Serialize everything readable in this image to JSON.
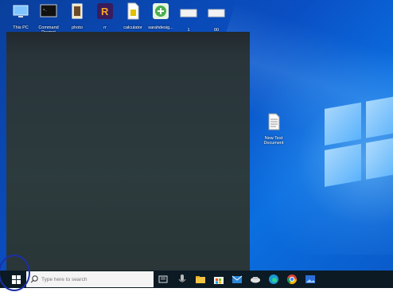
{
  "desktop": {
    "icons": [
      {
        "label": "This PC",
        "icon": "computer-icon"
      },
      {
        "label": "Command Prompt",
        "icon": "terminal-icon"
      },
      {
        "label": "photo",
        "icon": "photo-icon"
      },
      {
        "label": "rr",
        "icon": "app-icon"
      },
      {
        "label": "calculator",
        "icon": "document-icon"
      },
      {
        "label": "sarahdesig...",
        "icon": "app-icon"
      },
      {
        "label": "1",
        "icon": "folder-icon"
      },
      {
        "label": "00",
        "icon": "folder-icon"
      }
    ],
    "file_icon": {
      "label": "New Text Document",
      "icon": "text-file-icon"
    }
  },
  "taskbar": {
    "search": {
      "placeholder": "Type here to search"
    },
    "pinned": [
      "task-view-icon",
      "microphone-icon",
      "file-explorer-icon",
      "store-icon",
      "mail-icon",
      "phone-icon",
      "edge-icon",
      "chrome-icon",
      "photos-icon"
    ]
  },
  "colors": {
    "wallpaper": "#0a4fc4",
    "panel": "#2a3637",
    "taskbar": "#0c1a24",
    "annotation": "#1c2fa8"
  }
}
